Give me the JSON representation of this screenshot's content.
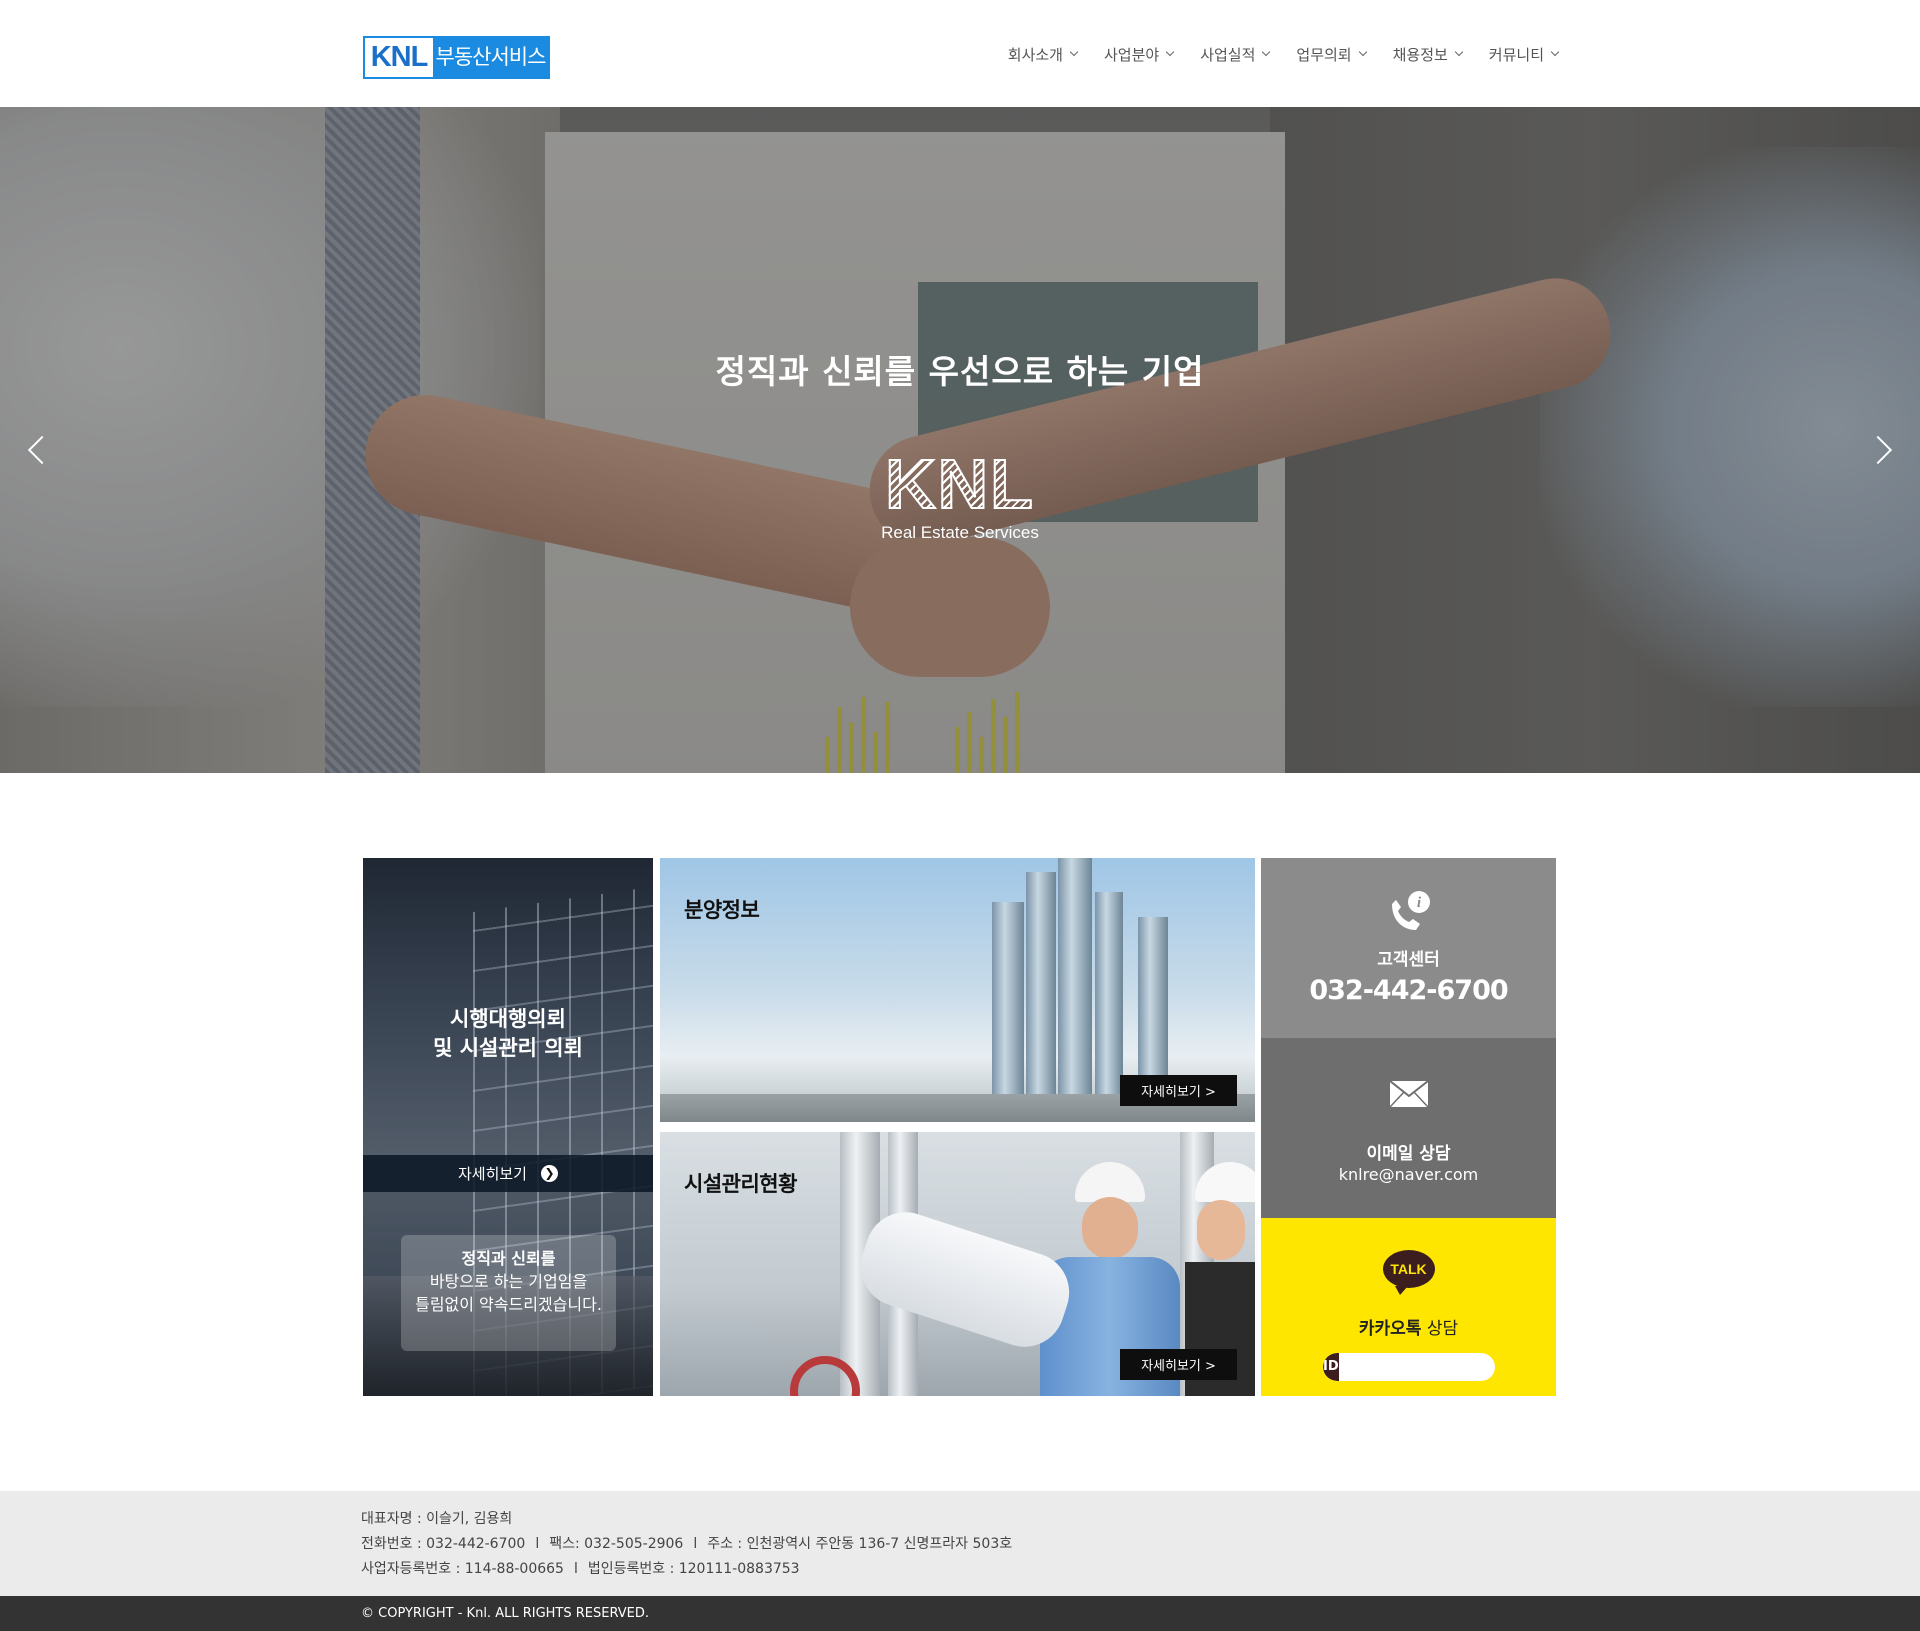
{
  "header": {
    "logo_en": "KNL",
    "logo_ko": "부동산서비스",
    "nav": [
      "회사소개",
      "사업분야",
      "사업실적",
      "업무의뢰",
      "채용정보",
      "커뮤니티"
    ]
  },
  "hero": {
    "title": "정직과 신뢰를 우선으로 하는 기업",
    "brand": "KNL",
    "brand_sub": "Real Estate Services"
  },
  "tiles": {
    "request": {
      "title_line1": "시행대행의뢰",
      "title_line2": "및 시설관리 의뢰",
      "more": "자세히보기",
      "note_line1": "정직과 신뢰를",
      "note_line2": "바탕으로 하는 기업임을",
      "note_line3": "틀림없이 약속드리겠습니다."
    },
    "sale": {
      "title": "분양정보",
      "more": "자세히보기 >"
    },
    "facility": {
      "title": "시설관리현황",
      "more": "자세히보기 >"
    }
  },
  "side": {
    "center_label": "고객센터",
    "phone": "032-442-6700",
    "email_label": "이메일 상담",
    "email": "knlre@naver.com",
    "kakao_bubble": "TALK",
    "kakao_label_bold": "카카오톡",
    "kakao_label_rest": " 상담",
    "kakao_id_tag": "ID",
    "kakao_id_value": ""
  },
  "footer": {
    "line1": "대표자명 : 이슬기, 김용희",
    "phone": "전화번호 : 032-442-6700",
    "fax": "팩스: 032-505-2906",
    "address": "주소 : 인천광역시 주안동 136-7 신명프라자 503호",
    "biz_no": "사업자등록번호 : 114-88-00665",
    "corp_no": "법인등록번호 : 120111-0883753",
    "separator": "l",
    "copyright": "© COPYRIGHT - Knl. ALL RIGHTS RESERVED."
  },
  "colors": {
    "brand_blue": "#1a8be0",
    "kakao_yellow": "#ffe600",
    "footer_bg": "#ebebeb",
    "copyright_bg": "#333333"
  },
  "icons": [
    "chevron-down-icon",
    "arrow-left-icon",
    "arrow-right-icon",
    "circle-arrow-icon",
    "phone-info-icon",
    "envelope-icon",
    "kakao-talk-icon"
  ]
}
